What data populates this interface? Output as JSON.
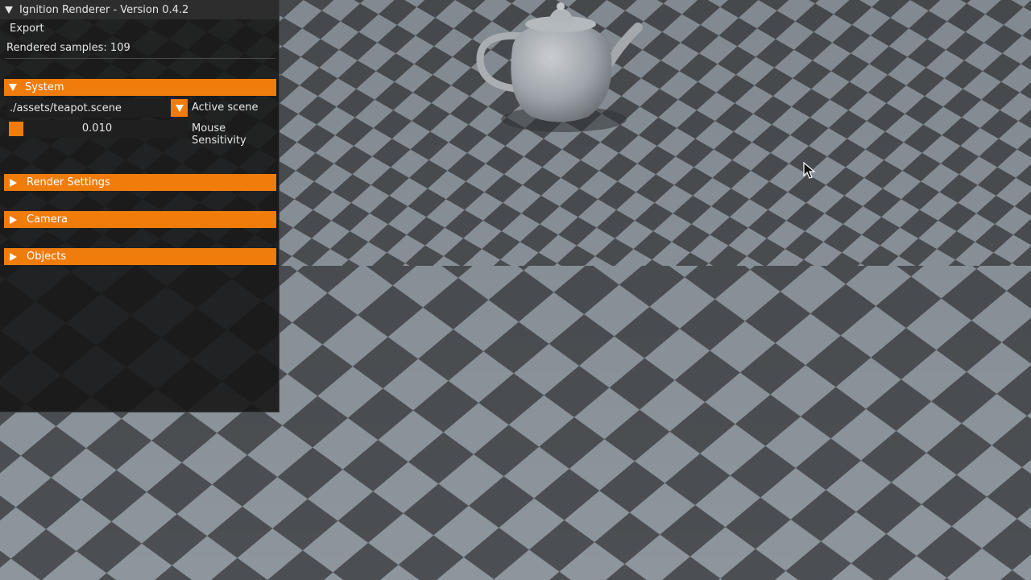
{
  "window": {
    "title": "Ignition Renderer - Version 0.4.2",
    "menu_export": "Export",
    "rendered_samples": "Rendered samples: 109"
  },
  "sections": {
    "system": "System",
    "render_settings": "Render Settings",
    "camera": "Camera",
    "objects": "Objects"
  },
  "system": {
    "scene_value": "./assets/teapot.scene",
    "scene_label": "Active scene",
    "mouse_sensitivity_value": "0.010",
    "mouse_sensitivity_label": "Mouse Sensitivity"
  },
  "colors": {
    "accent": "#ef7c0b",
    "panel_bg": "#161616",
    "checker_light": "#8d959d",
    "checker_dark": "#4b4f53"
  },
  "icons": {
    "collapse": "triangle-down-icon",
    "expand": "triangle-right-icon",
    "dropdown": "chevron-down-icon",
    "cursor": "mouse-pointer-icon"
  }
}
